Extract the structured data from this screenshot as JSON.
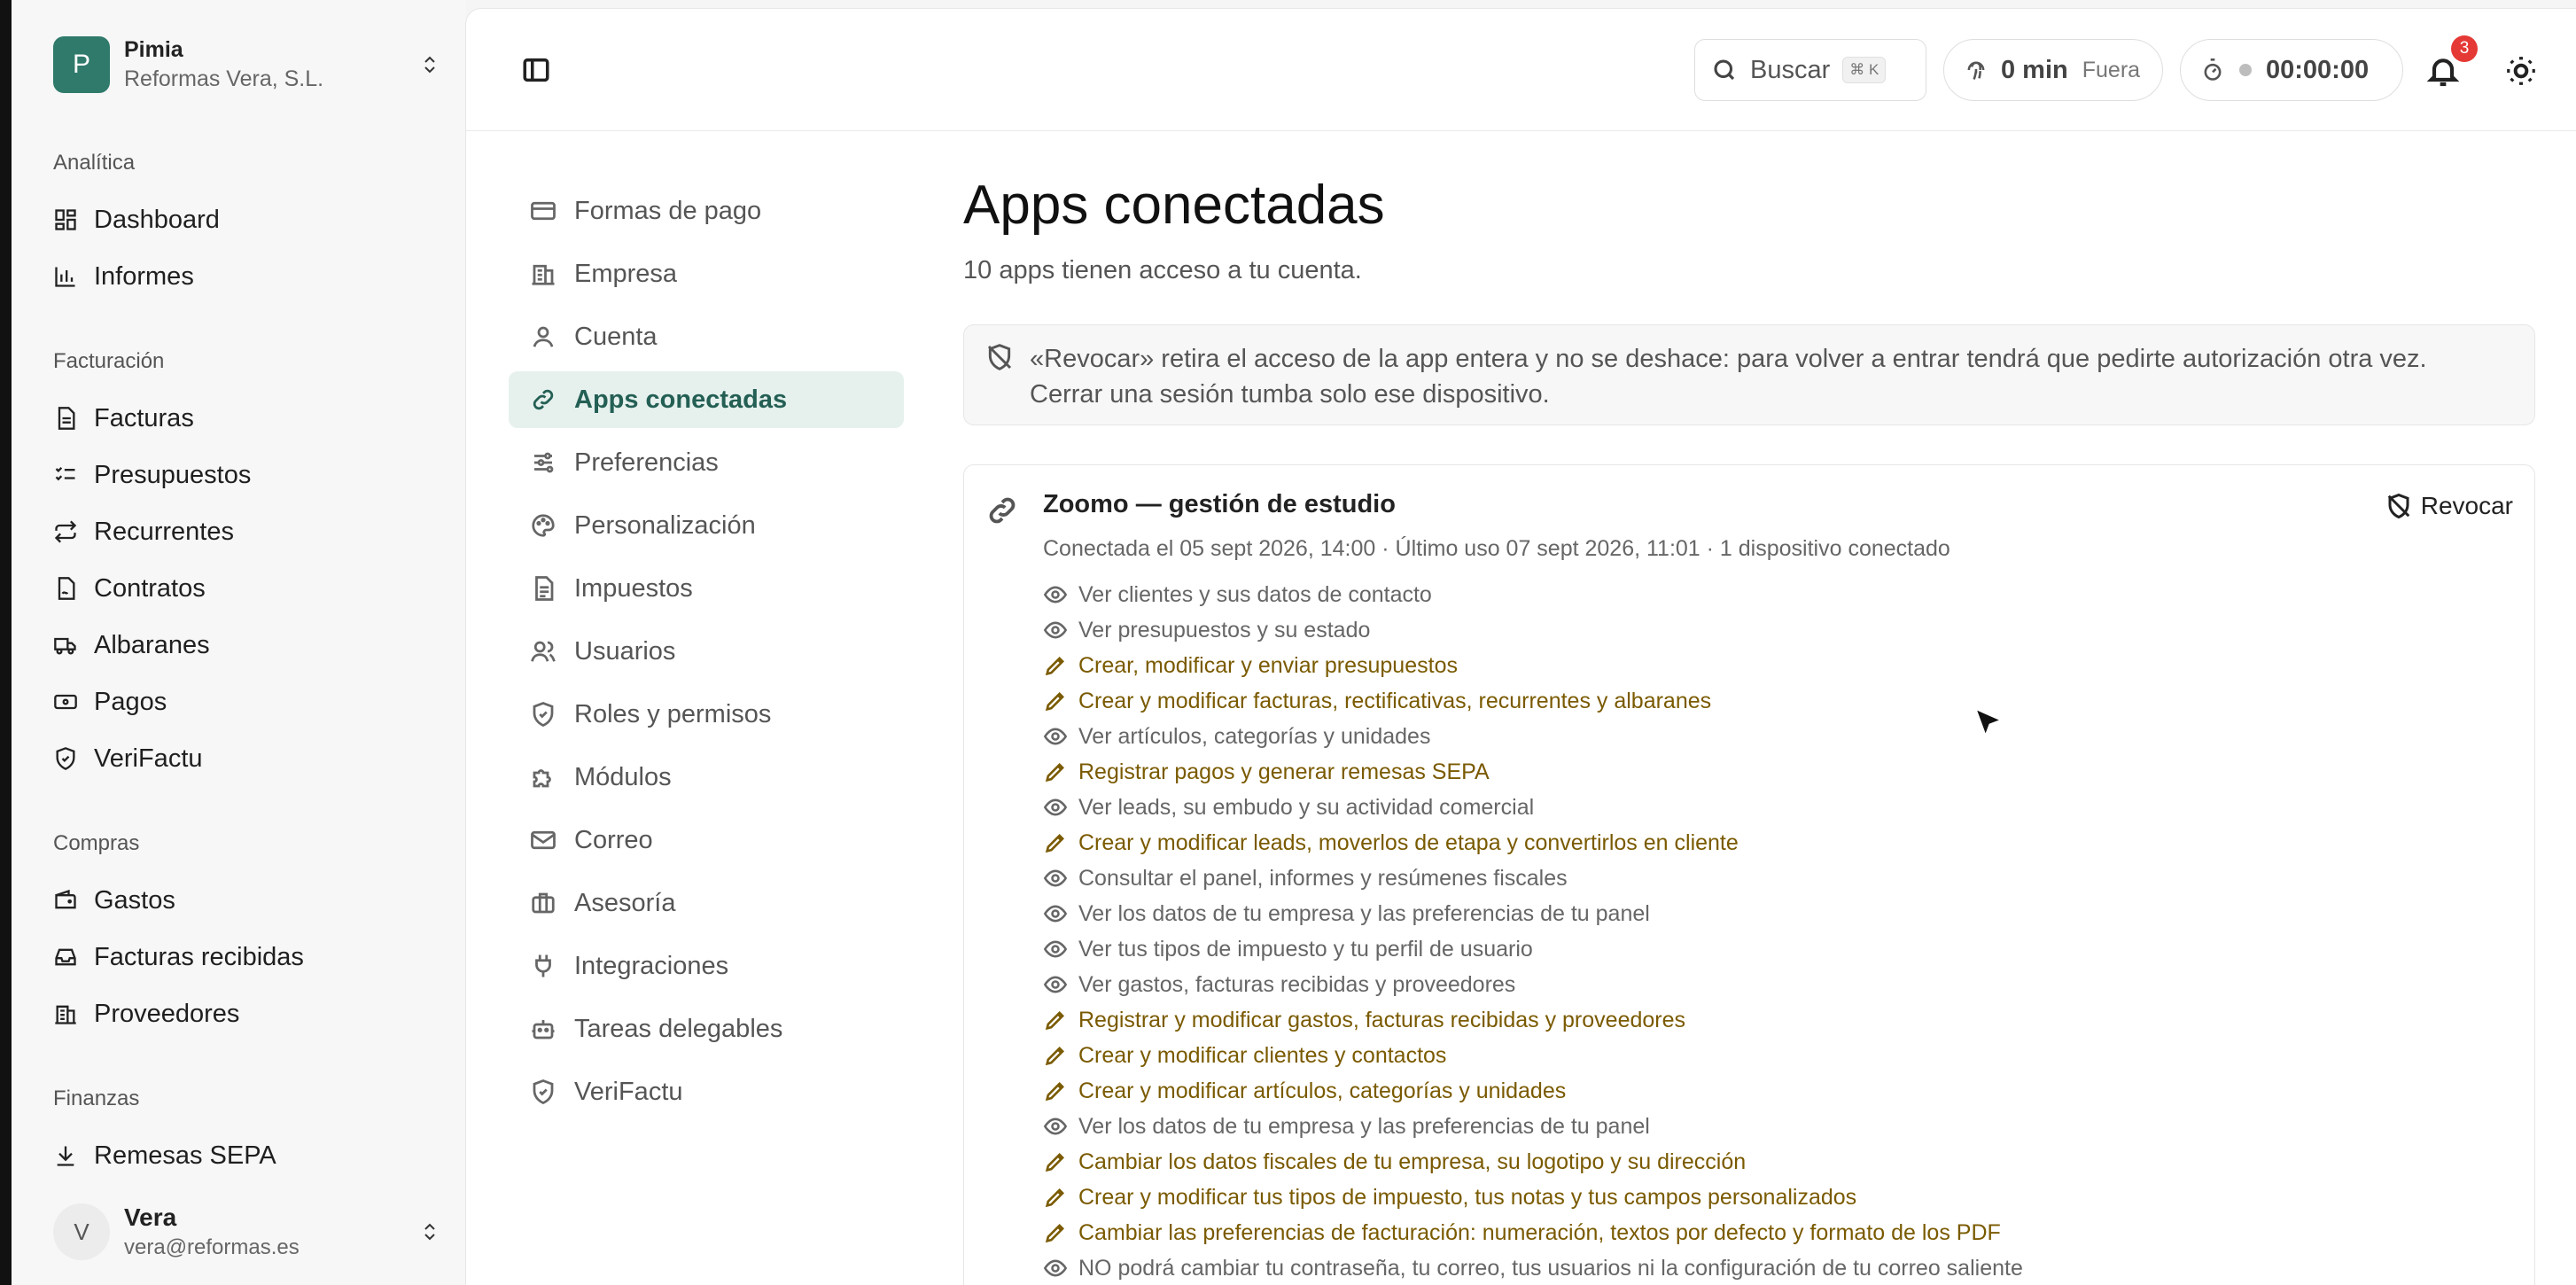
{
  "org": {
    "avatar": "P",
    "name": "Pimia",
    "company": "Reformas Vera, S.L."
  },
  "sidebar": {
    "sections": [
      {
        "title": "Analítica",
        "items": [
          {
            "label": "Dashboard",
            "icon": "dashboard-icon"
          },
          {
            "label": "Informes",
            "icon": "chart-icon"
          }
        ]
      },
      {
        "title": "Facturación",
        "items": [
          {
            "label": "Facturas",
            "icon": "file-icon"
          },
          {
            "label": "Presupuestos",
            "icon": "checklist-icon"
          },
          {
            "label": "Recurrentes",
            "icon": "repeat-icon"
          },
          {
            "label": "Contratos",
            "icon": "contract-icon"
          },
          {
            "label": "Albaranes",
            "icon": "truck-icon"
          },
          {
            "label": "Pagos",
            "icon": "cash-icon"
          },
          {
            "label": "VeriFactu",
            "icon": "shield-icon"
          }
        ]
      },
      {
        "title": "Compras",
        "items": [
          {
            "label": "Gastos",
            "icon": "wallet-icon"
          },
          {
            "label": "Facturas recibidas",
            "icon": "inbox-icon"
          },
          {
            "label": "Proveedores",
            "icon": "building-icon"
          }
        ]
      },
      {
        "title": "Finanzas",
        "items": [
          {
            "label": "Remesas SEPA",
            "icon": "download-icon"
          }
        ]
      }
    ]
  },
  "user": {
    "avatar": "V",
    "name": "Vera",
    "email": "vera@reformas.es"
  },
  "topbar": {
    "search_label": "Buscar",
    "search_shortcut": "⌘ K",
    "time_value": "0 min",
    "time_state": "Fuera",
    "timer_value": "00:00:00",
    "notifications": "3"
  },
  "settings_nav": [
    {
      "label": "Formas de pago",
      "icon": "card-icon",
      "active": false
    },
    {
      "label": "Empresa",
      "icon": "building-icon",
      "active": false
    },
    {
      "label": "Cuenta",
      "icon": "user-icon",
      "active": false
    },
    {
      "label": "Apps conectadas",
      "icon": "link-icon",
      "active": true
    },
    {
      "label": "Preferencias",
      "icon": "sliders-icon",
      "active": false
    },
    {
      "label": "Personalización",
      "icon": "palette-icon",
      "active": false
    },
    {
      "label": "Impuestos",
      "icon": "document-icon",
      "active": false
    },
    {
      "label": "Usuarios",
      "icon": "users-icon",
      "active": false
    },
    {
      "label": "Roles y permisos",
      "icon": "shield-icon",
      "active": false
    },
    {
      "label": "Módulos",
      "icon": "puzzle-icon",
      "active": false
    },
    {
      "label": "Correo",
      "icon": "mail-icon",
      "active": false
    },
    {
      "label": "Asesoría",
      "icon": "briefcase-icon",
      "active": false
    },
    {
      "label": "Integraciones",
      "icon": "plug-icon",
      "active": false
    },
    {
      "label": "Tareas delegables",
      "icon": "robot-icon",
      "active": false
    },
    {
      "label": "VeriFactu",
      "icon": "shield-icon",
      "active": false
    }
  ],
  "content": {
    "title": "Apps conectadas",
    "subtitle": "10 apps tienen acceso a tu cuenta.",
    "notice_line1": "«Revocar» retira el acceso de la app entera y no se deshace: para volver a entrar tendrá que pedirte autorización otra vez.",
    "notice_line2": "Cerrar una sesión tumba solo ese dispositivo.",
    "app": {
      "name": "Zoomo — gestión de estudio",
      "meta": "Conectada el 05 sept 2026, 14:00 · Último uso 07 sept 2026, 11:01 · 1 dispositivo conectado",
      "revoke_label": "Revocar",
      "permissions": [
        {
          "type": "view",
          "text": "Ver clientes y sus datos de contacto"
        },
        {
          "type": "view",
          "text": "Ver presupuestos y su estado"
        },
        {
          "type": "edit",
          "text": "Crear, modificar y enviar presupuestos"
        },
        {
          "type": "edit",
          "text": "Crear y modificar facturas, rectificativas, recurrentes y albaranes"
        },
        {
          "type": "view",
          "text": "Ver artículos, categorías y unidades"
        },
        {
          "type": "edit",
          "text": "Registrar pagos y generar remesas SEPA"
        },
        {
          "type": "view",
          "text": "Ver leads, su embudo y su actividad comercial"
        },
        {
          "type": "edit",
          "text": "Crear y modificar leads, moverlos de etapa y convertirlos en cliente"
        },
        {
          "type": "view",
          "text": "Consultar el panel, informes y resúmenes fiscales"
        },
        {
          "type": "view",
          "text": "Ver los datos de tu empresa y las preferencias de tu panel"
        },
        {
          "type": "view",
          "text": "Ver tus tipos de impuesto y tu perfil de usuario"
        },
        {
          "type": "view",
          "text": "Ver gastos, facturas recibidas y proveedores"
        },
        {
          "type": "edit",
          "text": "Registrar y modificar gastos, facturas recibidas y proveedores"
        },
        {
          "type": "edit",
          "text": "Crear y modificar clientes y contactos"
        },
        {
          "type": "edit",
          "text": "Crear y modificar artículos, categorías y unidades"
        },
        {
          "type": "view",
          "text": "Ver los datos de tu empresa y las preferencias de tu panel"
        },
        {
          "type": "edit",
          "text": "Cambiar los datos fiscales de tu empresa, su logotipo y su dirección"
        },
        {
          "type": "edit",
          "text": "Crear y modificar tus tipos de impuesto, tus notas y tus campos personalizados"
        },
        {
          "type": "edit",
          "text": "Cambiar las preferencias de facturación: numeración, textos por defecto y formato de los PDF"
        },
        {
          "type": "view",
          "text": "NO podrá cambiar tu contraseña, tu correo, tus usuarios ni la configuración de tu correo saliente"
        }
      ]
    }
  }
}
